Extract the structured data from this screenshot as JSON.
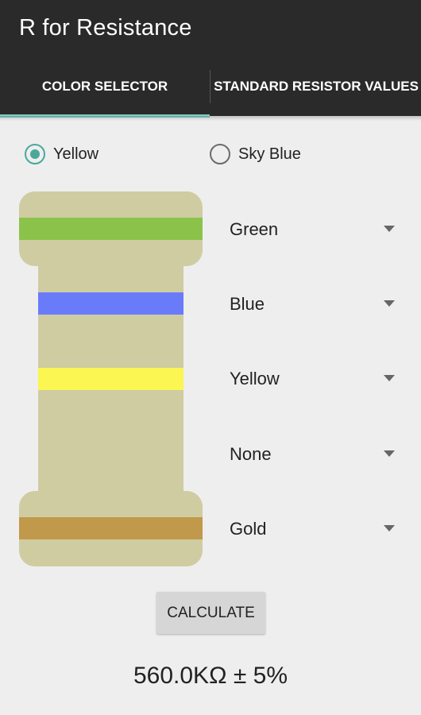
{
  "app": {
    "title": "R for Resistance"
  },
  "tabs": [
    {
      "label": "COLOR SELECTOR",
      "active": true
    },
    {
      "label": "STANDARD RESISTOR VALUES",
      "active": false
    }
  ],
  "body_color": {
    "options": [
      {
        "label": "Yellow",
        "selected": true
      },
      {
        "label": "Sky Blue",
        "selected": false
      }
    ]
  },
  "bands": [
    {
      "label": "Green",
      "color": "#8bc34a"
    },
    {
      "label": "Blue",
      "color": "#6a7bfa"
    },
    {
      "label": "Yellow",
      "color": "#fbf651"
    },
    {
      "label": "None",
      "color": null
    },
    {
      "label": "Gold",
      "color": "#c0994a"
    }
  ],
  "resistor": {
    "body_color": "#cfcca2"
  },
  "actions": {
    "calculate_label": "CALCULATE"
  },
  "result": {
    "text": "560.0KΩ ± 5%"
  },
  "colors": {
    "appbar": "#2a2a2a",
    "accent": "#4aa89a",
    "tab_indicator": "#80cbc4",
    "background": "#eeeeee"
  }
}
